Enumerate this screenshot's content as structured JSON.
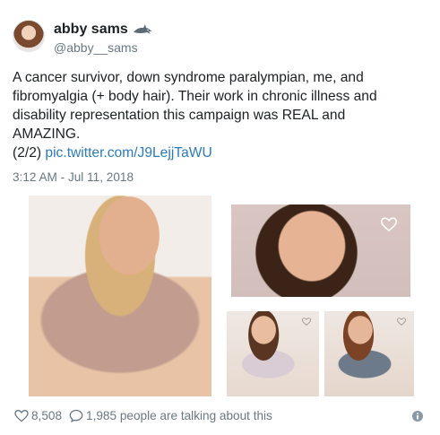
{
  "author": {
    "display_name": "abby sams",
    "handle": "@abby__sams",
    "badge_icon": "shark-icon"
  },
  "tweet": {
    "lines": [
      "A cancer survivor, down syndrome paralympian, me, and",
      "fibromyalgia (+ body hair). Their work in chronic illness and",
      "disability representation this campaign was REAL and",
      "AMAZING."
    ],
    "thread_marker": "(2/2)",
    "link_text": "pic.twitter.com/J9LejjTaWU",
    "timestamp": "3:12 AM - Jul 11, 2018"
  },
  "footer": {
    "likes": "8,508",
    "replies_text": "1,985 people are talking about this"
  },
  "colors": {
    "link": "#2b7bb9",
    "muted": "#697882",
    "text": "#1c2022"
  }
}
